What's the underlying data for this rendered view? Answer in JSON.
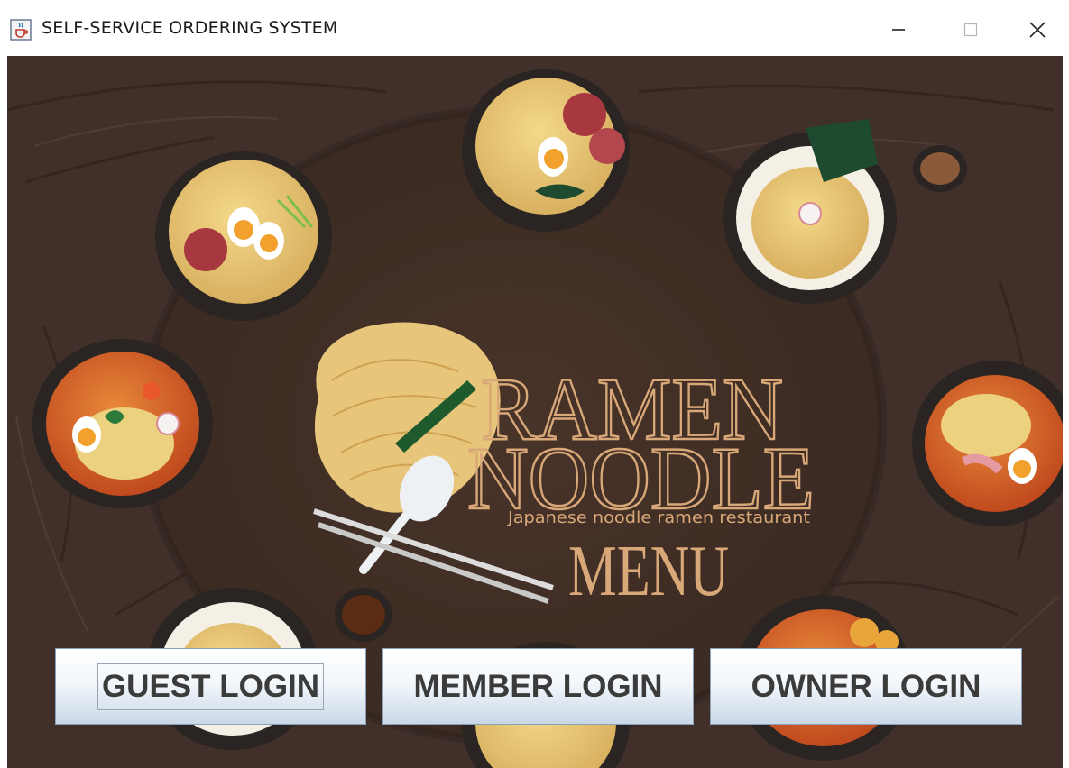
{
  "window": {
    "title": "SELF-SERVICE ORDERING SYSTEM",
    "icon": "java-cup-icon",
    "controls": [
      "minimize-icon",
      "maximize-icon",
      "close-icon"
    ]
  },
  "banner": {
    "line1": "RAMEN",
    "line2": "NOODLE",
    "tagline": "Japanese noodle ramen restaurant",
    "line3": "MENU"
  },
  "buttons": {
    "guest": "GUEST LOGIN",
    "member": "MEMBER LOGIN",
    "owner": "OWNER LOGIN"
  },
  "colors": {
    "background": "#3f2f28",
    "banner_text": "#d9a878",
    "button_text": "#3b3b3b"
  }
}
